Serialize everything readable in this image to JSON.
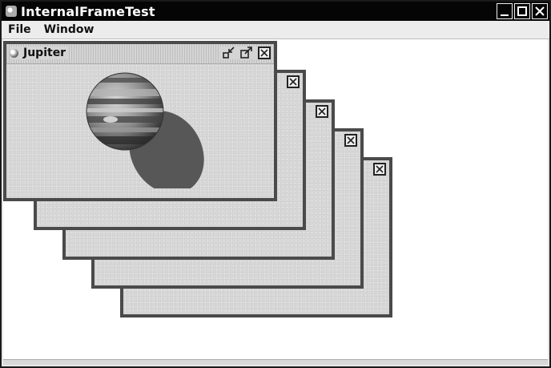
{
  "window": {
    "title": "InternalFrameTest",
    "controls": {
      "minimize_icon": "minimize-icon",
      "maximize_icon": "maximize-icon",
      "close_icon": "close-icon"
    }
  },
  "menubar": {
    "items": [
      {
        "label": "File"
      },
      {
        "label": "Window"
      }
    ]
  },
  "internal_frames": [
    {
      "title": "Jupiter",
      "icon": "planet-icon",
      "buttons": [
        "iconify-icon",
        "maximize-icon",
        "close-icon"
      ],
      "image": "jupiter-image"
    },
    {
      "title": "",
      "buttons": [
        "close-icon"
      ]
    },
    {
      "title": "",
      "buttons": [
        "close-icon"
      ]
    },
    {
      "title": "",
      "buttons": [
        "close-icon"
      ]
    },
    {
      "title": "",
      "buttons": [
        "close-icon"
      ]
    }
  ],
  "colors": {
    "titlebar": "#050505",
    "frame_border": "#4a4a4a",
    "frame_bg": "#d8d8d8",
    "desktop_bg": "#ffffff"
  }
}
